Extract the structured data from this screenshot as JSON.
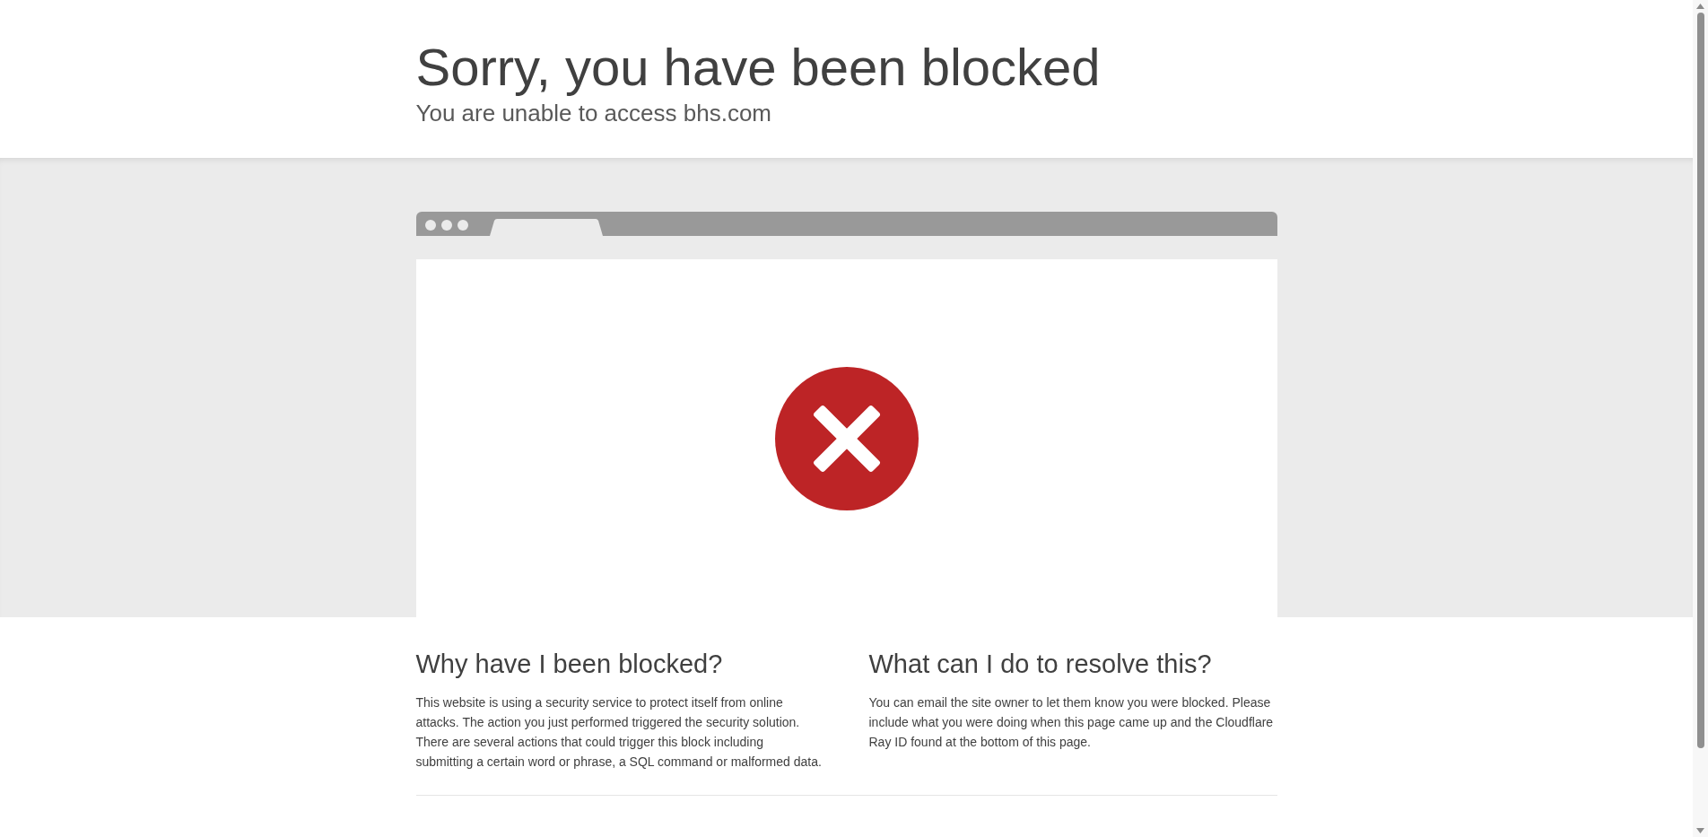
{
  "header": {
    "title": "Sorry, you have been blocked",
    "subtitle": "You are unable to access bhs.com"
  },
  "sections": [
    {
      "heading": "Why have I been blocked?",
      "text": "This website is using a security service to protect itself from online attacks. The action you just performed triggered the security solution. There are several actions that could trigger this block including submitting a certain word or phrase, a SQL command or malformed data."
    },
    {
      "heading": "What can I do to resolve this?",
      "text": "You can email the site owner to let them know you were blocked. Please include what you were doing when this page came up and the Cloudflare Ray ID found at the bottom of this page."
    }
  ]
}
